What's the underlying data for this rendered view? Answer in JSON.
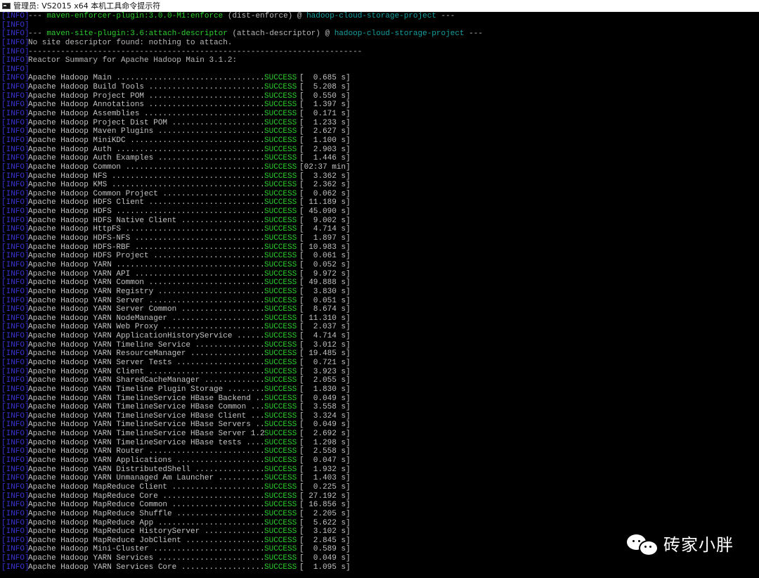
{
  "window": {
    "title": "管理员: VS2015 x64 本机工具命令提示符",
    "icon": "cmd-icon"
  },
  "log_tag": "[INFO]",
  "header_lines": [
    {
      "prefix": "--- ",
      "plugin": "maven-enforcer-plugin:3.0.0-M1:enforce",
      "middle": " (dist-enforce) @ ",
      "project": "hadoop-cloud-storage-project",
      "suffix": " ---"
    },
    {
      "prefix": "",
      "plugin": "",
      "middle": "",
      "project": "",
      "suffix": ""
    },
    {
      "prefix": "--- ",
      "plugin": "maven-site-plugin:3.6:attach-descriptor",
      "middle": " (attach-descriptor) @ ",
      "project": "hadoop-cloud-storage-project",
      "suffix": " ---"
    }
  ],
  "messages": {
    "no_site": "No site descriptor found: nothing to attach.",
    "separator": "------------------------------------------------------------------------",
    "blank": "",
    "summary_title": "Reactor Summary for Apache Hadoop Main 3.1.2:"
  },
  "modules": [
    {
      "name": "Apache Hadoop Main ................................",
      "status": "SUCCESS",
      "time": "[  0.685 s]"
    },
    {
      "name": "Apache Hadoop Build Tools .........................",
      "status": "SUCCESS",
      "time": "[  5.208 s]"
    },
    {
      "name": "Apache Hadoop Project POM .........................",
      "status": "SUCCESS",
      "time": "[  0.550 s]"
    },
    {
      "name": "Apache Hadoop Annotations .........................",
      "status": "SUCCESS",
      "time": "[  1.397 s]"
    },
    {
      "name": "Apache Hadoop Assemblies ..........................",
      "status": "SUCCESS",
      "time": "[  0.171 s]"
    },
    {
      "name": "Apache Hadoop Project Dist POM ....................",
      "status": "SUCCESS",
      "time": "[  1.233 s]"
    },
    {
      "name": "Apache Hadoop Maven Plugins .......................",
      "status": "SUCCESS",
      "time": "[  2.627 s]"
    },
    {
      "name": "Apache Hadoop MiniKDC .............................",
      "status": "SUCCESS",
      "time": "[  1.100 s]"
    },
    {
      "name": "Apache Hadoop Auth ................................",
      "status": "SUCCESS",
      "time": "[  2.903 s]"
    },
    {
      "name": "Apache Hadoop Auth Examples .......................",
      "status": "SUCCESS",
      "time": "[  1.446 s]"
    },
    {
      "name": "Apache Hadoop Common ..............................",
      "status": "SUCCESS",
      "time": "[02:37 min]"
    },
    {
      "name": "Apache Hadoop NFS .................................",
      "status": "SUCCESS",
      "time": "[  3.362 s]"
    },
    {
      "name": "Apache Hadoop KMS .................................",
      "status": "SUCCESS",
      "time": "[  2.362 s]"
    },
    {
      "name": "Apache Hadoop Common Project ......................",
      "status": "SUCCESS",
      "time": "[  0.062 s]"
    },
    {
      "name": "Apache Hadoop HDFS Client .........................",
      "status": "SUCCESS",
      "time": "[ 11.189 s]"
    },
    {
      "name": "Apache Hadoop HDFS ................................",
      "status": "SUCCESS",
      "time": "[ 45.090 s]"
    },
    {
      "name": "Apache Hadoop HDFS Native Client ..................",
      "status": "SUCCESS",
      "time": "[  9.002 s]"
    },
    {
      "name": "Apache Hadoop HttpFS ..............................",
      "status": "SUCCESS",
      "time": "[  4.714 s]"
    },
    {
      "name": "Apache Hadoop HDFS-NFS ............................",
      "status": "SUCCESS",
      "time": "[  1.897 s]"
    },
    {
      "name": "Apache Hadoop HDFS-RBF ............................",
      "status": "SUCCESS",
      "time": "[ 10.983 s]"
    },
    {
      "name": "Apache Hadoop HDFS Project ........................",
      "status": "SUCCESS",
      "time": "[  0.061 s]"
    },
    {
      "name": "Apache Hadoop YARN ................................",
      "status": "SUCCESS",
      "time": "[  0.052 s]"
    },
    {
      "name": "Apache Hadoop YARN API ............................",
      "status": "SUCCESS",
      "time": "[  9.972 s]"
    },
    {
      "name": "Apache Hadoop YARN Common .........................",
      "status": "SUCCESS",
      "time": "[ 49.888 s]"
    },
    {
      "name": "Apache Hadoop YARN Registry .......................",
      "status": "SUCCESS",
      "time": "[  3.830 s]"
    },
    {
      "name": "Apache Hadoop YARN Server .........................",
      "status": "SUCCESS",
      "time": "[  0.051 s]"
    },
    {
      "name": "Apache Hadoop YARN Server Common ..................",
      "status": "SUCCESS",
      "time": "[  8.674 s]"
    },
    {
      "name": "Apache Hadoop YARN NodeManager ....................",
      "status": "SUCCESS",
      "time": "[ 11.310 s]"
    },
    {
      "name": "Apache Hadoop YARN Web Proxy ......................",
      "status": "SUCCESS",
      "time": "[  2.037 s]"
    },
    {
      "name": "Apache Hadoop YARN ApplicationHistoryService ......",
      "status": "SUCCESS",
      "time": "[  4.714 s]"
    },
    {
      "name": "Apache Hadoop YARN Timeline Service ...............",
      "status": "SUCCESS",
      "time": "[  3.012 s]"
    },
    {
      "name": "Apache Hadoop YARN ResourceManager ................",
      "status": "SUCCESS",
      "time": "[ 19.485 s]"
    },
    {
      "name": "Apache Hadoop YARN Server Tests ...................",
      "status": "SUCCESS",
      "time": "[  0.721 s]"
    },
    {
      "name": "Apache Hadoop YARN Client .........................",
      "status": "SUCCESS",
      "time": "[  3.923 s]"
    },
    {
      "name": "Apache Hadoop YARN SharedCacheManager .............",
      "status": "SUCCESS",
      "time": "[  2.055 s]"
    },
    {
      "name": "Apache Hadoop YARN Timeline Plugin Storage ........",
      "status": "SUCCESS",
      "time": "[  1.830 s]"
    },
    {
      "name": "Apache Hadoop YARN TimelineService HBase Backend ...",
      "status": "SUCCESS",
      "time": "[  0.049 s]"
    },
    {
      "name": "Apache Hadoop YARN TimelineService HBase Common ....",
      "status": "SUCCESS",
      "time": "[  3.558 s]"
    },
    {
      "name": "Apache Hadoop YARN TimelineService HBase Client ....",
      "status": "SUCCESS",
      "time": "[  3.324 s]"
    },
    {
      "name": "Apache Hadoop YARN TimelineService HBase Servers ....",
      "status": "SUCCESS",
      "time": "[  0.049 s]"
    },
    {
      "name": "Apache Hadoop YARN TimelineService HBase Server 1.2",
      "status": "SUCCESS",
      "time": "[  2.692 s]"
    },
    {
      "name": "Apache Hadoop YARN TimelineService HBase tests .....",
      "status": "SUCCESS",
      "time": "[  1.298 s]"
    },
    {
      "name": "Apache Hadoop YARN Router .........................",
      "status": "SUCCESS",
      "time": "[  2.558 s]"
    },
    {
      "name": "Apache Hadoop YARN Applications ...................",
      "status": "SUCCESS",
      "time": "[  0.047 s]"
    },
    {
      "name": "Apache Hadoop YARN DistributedShell ...............",
      "status": "SUCCESS",
      "time": "[  1.932 s]"
    },
    {
      "name": "Apache Hadoop YARN Unmanaged Am Launcher ..........",
      "status": "SUCCESS",
      "time": "[  1.403 s]"
    },
    {
      "name": "Apache Hadoop MapReduce Client ....................",
      "status": "SUCCESS",
      "time": "[  0.225 s]"
    },
    {
      "name": "Apache Hadoop MapReduce Core ......................",
      "status": "SUCCESS",
      "time": "[ 27.192 s]"
    },
    {
      "name": "Apache Hadoop MapReduce Common ....................",
      "status": "SUCCESS",
      "time": "[ 16.856 s]"
    },
    {
      "name": "Apache Hadoop MapReduce Shuffle ...................",
      "status": "SUCCESS",
      "time": "[  2.205 s]"
    },
    {
      "name": "Apache Hadoop MapReduce App .......................",
      "status": "SUCCESS",
      "time": "[  5.622 s]"
    },
    {
      "name": "Apache Hadoop MapReduce HistoryServer .............",
      "status": "SUCCESS",
      "time": "[  3.102 s]"
    },
    {
      "name": "Apache Hadoop MapReduce JobClient .................",
      "status": "SUCCESS",
      "time": "[  2.845 s]"
    },
    {
      "name": "Apache Hadoop Mini-Cluster ........................",
      "status": "SUCCESS",
      "time": "[  0.589 s]"
    },
    {
      "name": "Apache Hadoop YARN Services .......................",
      "status": "SUCCESS",
      "time": "[  0.049 s]"
    },
    {
      "name": "Apache Hadoop YARN Services Core ..................",
      "status": "SUCCESS",
      "time": "[  1.095 s]"
    }
  ],
  "watermark": {
    "icon": "wechat-icon",
    "text": "砖家小胖"
  },
  "colors": {
    "background": "#000000",
    "info_tag": "#3a35d6",
    "success": "#2ccf2c",
    "plugin": "#16a0a0"
  }
}
